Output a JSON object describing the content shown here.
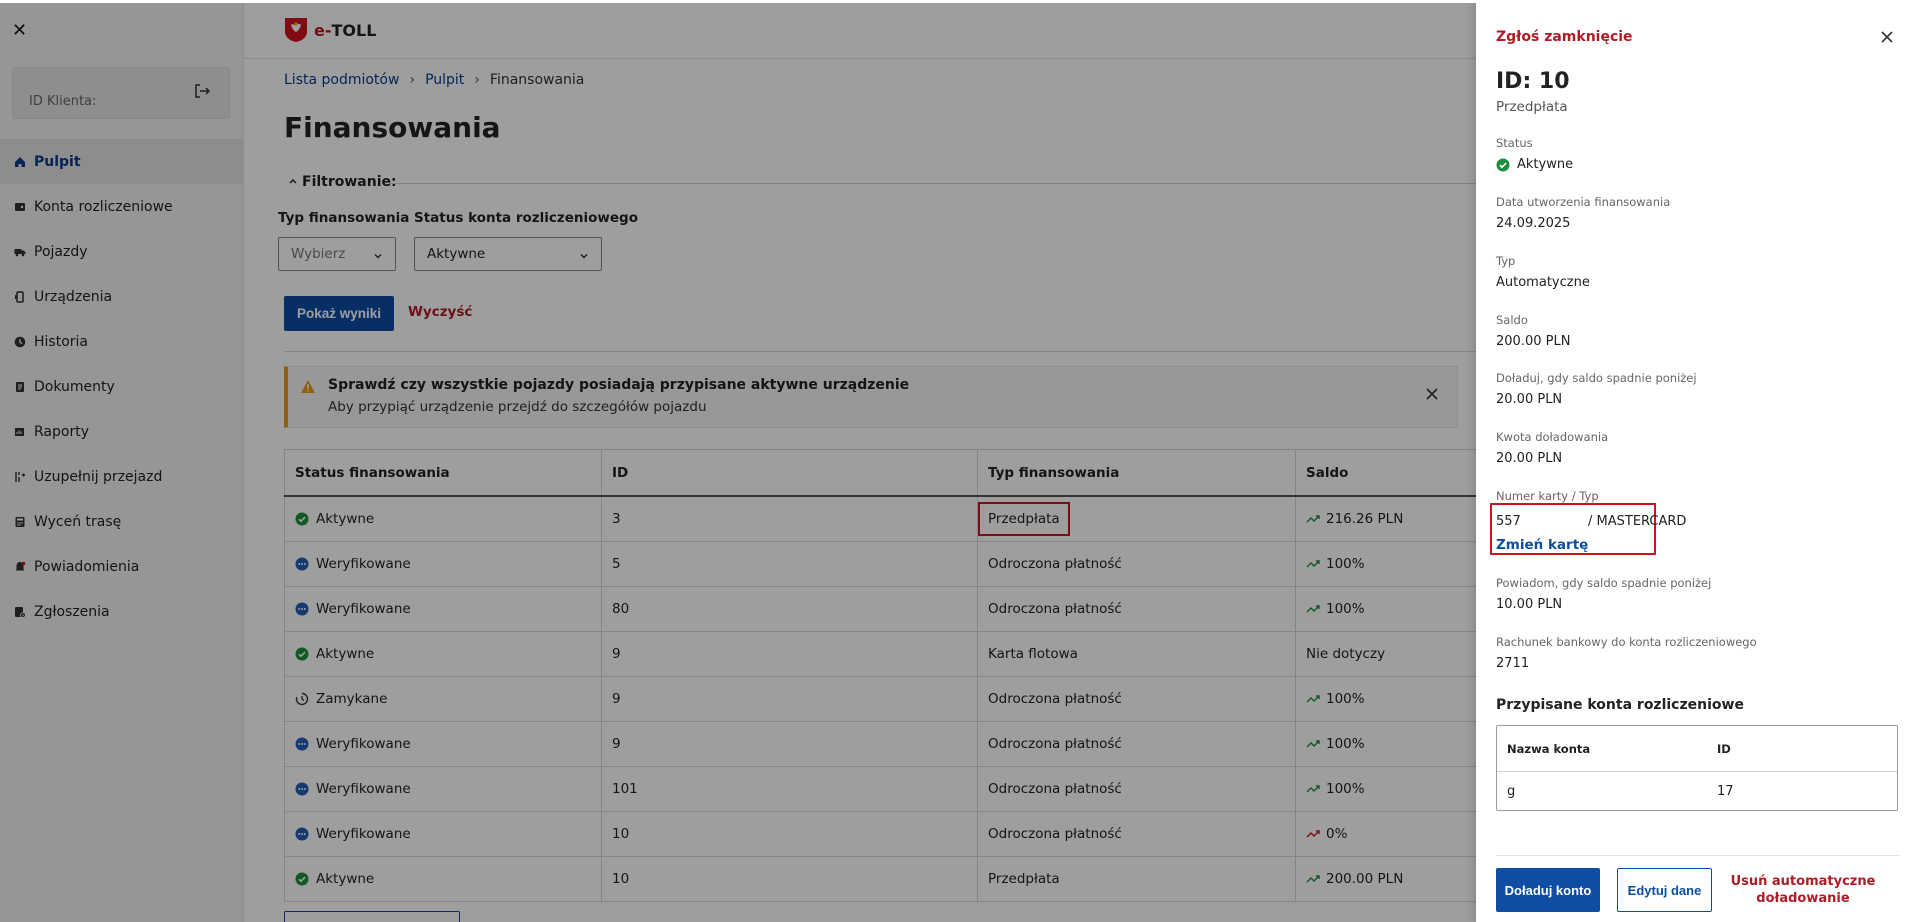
{
  "sidebar": {
    "client_label": "ID Klienta:",
    "items": [
      {
        "label": "Pulpit",
        "icon": "home-icon",
        "active": true
      },
      {
        "label": "Konta rozliczeniowe",
        "icon": "wallet-icon"
      },
      {
        "label": "Pojazdy",
        "icon": "truck-icon"
      },
      {
        "label": "Urządzenia",
        "icon": "device-icon"
      },
      {
        "label": "Historia",
        "icon": "clock-icon"
      },
      {
        "label": "Dokumenty",
        "icon": "document-icon"
      },
      {
        "label": "Raporty",
        "icon": "report-icon"
      },
      {
        "label": "Uzupełnij przejazd",
        "icon": "route-icon"
      },
      {
        "label": "Wyceń trasę",
        "icon": "calculator-icon"
      },
      {
        "label": "Powiadomienia",
        "icon": "bell-icon"
      },
      {
        "label": "Zgłoszenia",
        "icon": "ticket-icon"
      }
    ]
  },
  "header": {
    "logo_e": "e-",
    "logo_toll": "TOLL"
  },
  "breadcrumb": {
    "items": [
      "Lista podmiotów",
      "Pulpit"
    ],
    "current": "Finansowania",
    "separator": "›"
  },
  "page": {
    "title": "Finansowania"
  },
  "filters": {
    "heading": "Filtrowanie:",
    "type_label": "Typ finansowania",
    "type_placeholder": "Wybierz",
    "status_label": "Status konta rozliczeniowego",
    "status_value": "Aktywne",
    "show_button": "Pokaż wyniki",
    "clear_button": "Wyczyść"
  },
  "alert": {
    "title": "Sprawdź czy wszystkie pojazdy posiadają przypisane aktywne urządzenie",
    "text": "Aby przypiąć urządzenie przejdź do szczegółów pojazdu"
  },
  "table": {
    "columns": [
      "Status finansowania",
      "ID",
      "Typ finansowania",
      "Saldo"
    ],
    "rows": [
      {
        "status": "Aktywne",
        "status_kind": "active",
        "id": "3",
        "type": "Przedpłata",
        "saldo": "216.26 PLN",
        "trend": "up",
        "highlight": true
      },
      {
        "status": "Weryfikowane",
        "status_kind": "verifying",
        "id": "5",
        "type": "Odroczona płatność",
        "saldo": "100%",
        "trend": "up"
      },
      {
        "status": "Weryfikowane",
        "status_kind": "verifying",
        "id": "80",
        "type": "Odroczona płatność",
        "saldo": "100%",
        "trend": "up"
      },
      {
        "status": "Aktywne",
        "status_kind": "active",
        "id": "9",
        "type": "Karta flotowa",
        "saldo": "Nie dotyczy",
        "trend": "none"
      },
      {
        "status": "Zamykane",
        "status_kind": "closing",
        "id": "9",
        "type": "Odroczona płatność",
        "saldo": "100%",
        "trend": "up"
      },
      {
        "status": "Weryfikowane",
        "status_kind": "verifying",
        "id": "9",
        "type": "Odroczona płatność",
        "saldo": "100%",
        "trend": "up"
      },
      {
        "status": "Weryfikowane",
        "status_kind": "verifying",
        "id": "101",
        "type": "Odroczona płatność",
        "saldo": "100%",
        "trend": "up"
      },
      {
        "status": "Weryfikowane",
        "status_kind": "verifying",
        "id": "10",
        "type": "Odroczona płatność",
        "saldo": "0%",
        "trend": "down"
      },
      {
        "status": "Aktywne",
        "status_kind": "active",
        "id": "10",
        "type": "Przedpłata",
        "saldo": "200.00 PLN",
        "trend": "up"
      }
    ]
  },
  "panel": {
    "close_request": "Zgłoś zamknięcie",
    "id": "ID: 10",
    "type": "Przedpłata",
    "status_label": "Status",
    "status_value": "Aktywne",
    "created_label": "Data utworzenia finansowania",
    "created_value": "24.09.2025",
    "typ_label": "Typ",
    "typ_value": "Automatyczne",
    "saldo_label": "Saldo",
    "saldo_value": "200.00 PLN",
    "topup_threshold_label": "Doładuj, gdy saldo spadnie poniżej",
    "topup_threshold_value": "20.00 PLN",
    "topup_amount_label": "Kwota doładowania",
    "topup_amount_value": "20.00 PLN",
    "card_label": "Numer karty / Typ",
    "card_number": "557",
    "card_type": "/ MASTERCARD",
    "change_card": "Zmień kartę",
    "notify_label": "Powiadom, gdy saldo spadnie poniżej",
    "notify_value": "10.00 PLN",
    "bank_label": "Rachunek bankowy do konta rozliczeniowego",
    "bank_value": "2711",
    "assigned_title": "Przypisane konta rozliczeniowe",
    "assigned_columns": [
      "Nazwa konta",
      "ID"
    ],
    "assigned_rows": [
      {
        "name": "g",
        "id": "17"
      }
    ],
    "btn_topup": "Doładuj konto",
    "btn_edit": "Edytuj dane",
    "btn_remove": "Usuń automatyczne doładowanie"
  },
  "colors": {
    "primary": "#0d4da3",
    "danger": "#b11b26",
    "active_green": "#1e8e3e",
    "verifying_blue": "#1f5fb8",
    "warning": "#e59b1d"
  }
}
